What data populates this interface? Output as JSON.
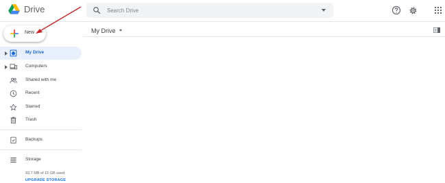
{
  "app": {
    "name": "Drive"
  },
  "search": {
    "placeholder": "Search Drive"
  },
  "toolbar": {
    "icons": [
      "help-icon",
      "gear-icon",
      "apps-icon"
    ]
  },
  "sidebar": {
    "new_label": "New",
    "items": [
      {
        "label": "My Drive",
        "icon": "my-drive-icon",
        "active": true,
        "expandable": true
      },
      {
        "label": "Computers",
        "icon": "computers-icon",
        "active": false,
        "expandable": true
      },
      {
        "label": "Shared with me",
        "icon": "shared-icon",
        "active": false,
        "expandable": false
      },
      {
        "label": "Recent",
        "icon": "clock-icon",
        "active": false,
        "expandable": false
      },
      {
        "label": "Starred",
        "icon": "star-icon",
        "active": false,
        "expandable": false
      },
      {
        "label": "Trash",
        "icon": "trash-icon",
        "active": false,
        "expandable": false
      },
      {
        "label": "Backups",
        "icon": "backups-icon",
        "active": false,
        "expandable": false
      },
      {
        "label": "Storage",
        "icon": "storage-icon",
        "active": false,
        "expandable": false
      }
    ],
    "storage": {
      "used_text": "93.7 MB of 15 GB used",
      "upgrade_label": "UPGRADE STORAGE"
    }
  },
  "main": {
    "title": "My Drive"
  },
  "colors": {
    "accent": "#1a73e8",
    "active_bg": "#e8f0fe",
    "annotation_arrow": "#c62828"
  }
}
